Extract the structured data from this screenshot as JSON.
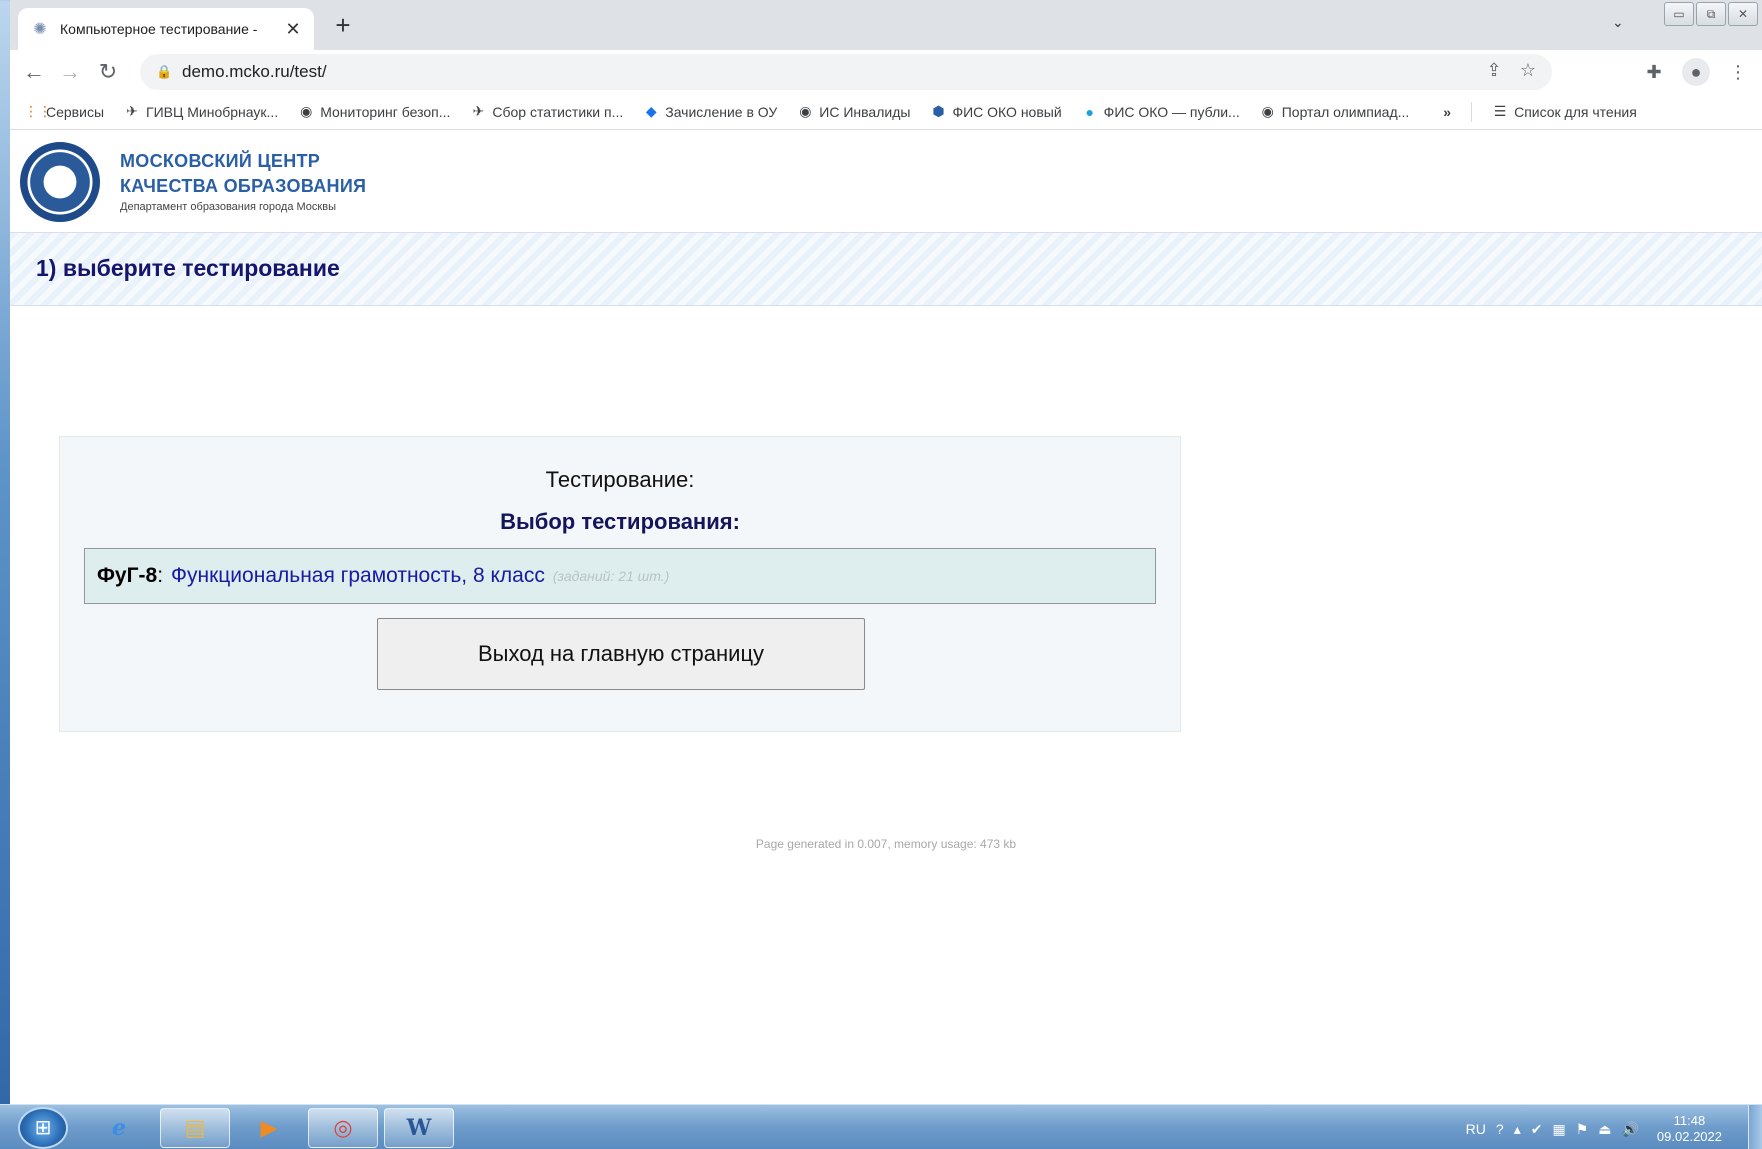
{
  "browser": {
    "tab_title": "Компьютерное тестирование - ",
    "tab_close": "✕",
    "new_tab": "+",
    "tab_dropdown": "⌄",
    "window_controls": {
      "minimize": "▭",
      "maximize": "⧉",
      "close": "✕"
    },
    "address": "demo.mcko.ru/test/",
    "nav": {
      "back": "←",
      "forward": "→",
      "reload": "↻"
    }
  },
  "bookmarks": {
    "items": [
      {
        "icon": "apps-grid-icon",
        "label": "Сервисы"
      },
      {
        "icon": "bird-icon",
        "label": "ГИВЦ Минобрнаук..."
      },
      {
        "icon": "globe-icon",
        "label": "Мониторинг безоп..."
      },
      {
        "icon": "bird-icon",
        "label": "Сбор статистики п..."
      },
      {
        "icon": "diamond-icon",
        "label": "Зачисление в ОУ"
      },
      {
        "icon": "globe-icon",
        "label": "ИС Инвалиды"
      },
      {
        "icon": "shield-icon",
        "label": "ФИС ОКО новый"
      },
      {
        "icon": "circle-icon",
        "label": "ФИС ОКО — публи..."
      },
      {
        "icon": "globe-icon",
        "label": "Портал олимпиад..."
      }
    ],
    "more": "»",
    "reading_list": "Список для чтения"
  },
  "site": {
    "logo_line1": "МОСКОВСКИЙ ЦЕНТР",
    "logo_line2": "КАЧЕСТВА ОБРАЗОВАНИЯ",
    "logo_sub": "Департамент образования города Москвы"
  },
  "step": {
    "title": "1) выберите тестирование"
  },
  "panel": {
    "label": "Тестирование:",
    "heading": "Выбор тестирования:",
    "test": {
      "code": "ФуГ-8",
      "colon": ":",
      "name": "Функциональная грамотность, 8 класс",
      "count": "(заданий: 21 шт.)"
    },
    "exit_button": "Выход на главную страницу"
  },
  "footer": {
    "note": "Page generated in 0.007, memory usage: 473 kb"
  },
  "taskbar": {
    "lang": "RU",
    "time": "11:48",
    "date": "09.02.2022",
    "apps": [
      "start-orb",
      "internet-explorer",
      "file-explorer",
      "media-player",
      "chrome",
      "word"
    ]
  }
}
